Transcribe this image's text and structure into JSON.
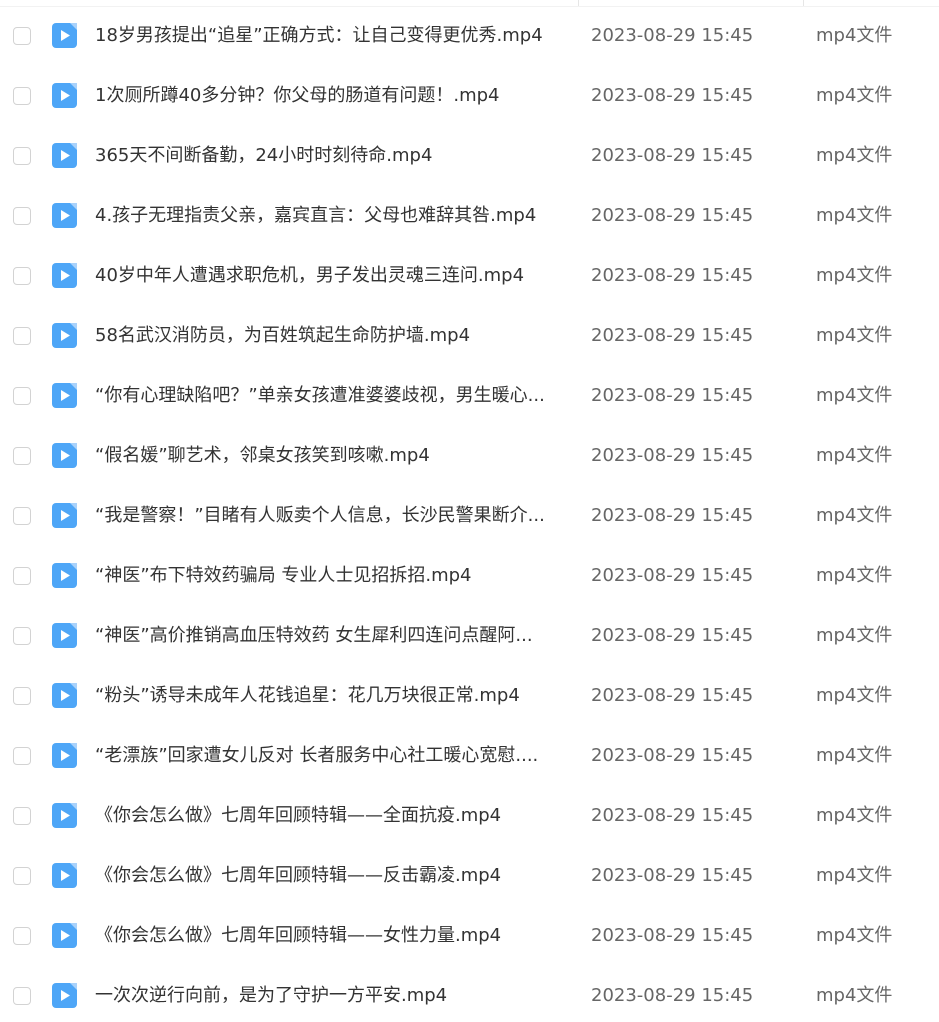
{
  "files": [
    {
      "name": "18岁男孩提出“追星”正确方式：让自己变得更优秀.mp4",
      "date": "2023-08-29 15:45",
      "type": "mp4文件",
      "icon": "video-file-icon"
    },
    {
      "name": "1次厕所蹲40多分钟？你父母的肠道有问题！.mp4",
      "date": "2023-08-29 15:45",
      "type": "mp4文件",
      "icon": "video-file-icon"
    },
    {
      "name": "365天不间断备勤，24小时时刻待命.mp4",
      "date": "2023-08-29 15:45",
      "type": "mp4文件",
      "icon": "video-file-icon"
    },
    {
      "name": "4.孩子无理指责父亲，嘉宾直言：父母也难辞其咎.mp4",
      "date": "2023-08-29 15:45",
      "type": "mp4文件",
      "icon": "video-file-icon"
    },
    {
      "name": "40岁中年人遭遇求职危机，男子发出灵魂三连问.mp4",
      "date": "2023-08-29 15:45",
      "type": "mp4文件",
      "icon": "video-file-icon"
    },
    {
      "name": "58名武汉消防员，为百姓筑起生命防护墙.mp4",
      "date": "2023-08-29 15:45",
      "type": "mp4文件",
      "icon": "video-file-icon"
    },
    {
      "name": "“你有心理缺陷吧？”单亲女孩遭准婆婆歧视，男生暖心...",
      "date": "2023-08-29 15:45",
      "type": "mp4文件",
      "icon": "video-file-icon"
    },
    {
      "name": "“假名媛”聊艺术，邻桌女孩笑到咳嗽.mp4",
      "date": "2023-08-29 15:45",
      "type": "mp4文件",
      "icon": "video-file-icon"
    },
    {
      "name": "“我是警察！”目睹有人贩卖个人信息，长沙民警果断介...",
      "date": "2023-08-29 15:45",
      "type": "mp4文件",
      "icon": "video-file-icon"
    },
    {
      "name": "“神医”布下特效药骗局  专业人士见招拆招.mp4",
      "date": "2023-08-29 15:45",
      "type": "mp4文件",
      "icon": "video-file-icon"
    },
    {
      "name": "“神医”高价推销高血压特效药  女生犀利四连问点醒阿...",
      "date": "2023-08-29 15:45",
      "type": "mp4文件",
      "icon": "video-file-icon"
    },
    {
      "name": "“粉头”诱导未成年人花钱追星：花几万块很正常.mp4",
      "date": "2023-08-29 15:45",
      "type": "mp4文件",
      "icon": "video-file-icon"
    },
    {
      "name": "“老漂族”回家遭女儿反对  长者服务中心社工暖心宽慰....",
      "date": "2023-08-29 15:45",
      "type": "mp4文件",
      "icon": "video-file-icon"
    },
    {
      "name": "《你会怎么做》七周年回顾特辑——全面抗疫.mp4",
      "date": "2023-08-29 15:45",
      "type": "mp4文件",
      "icon": "video-file-icon"
    },
    {
      "name": "《你会怎么做》七周年回顾特辑——反击霸凌.mp4",
      "date": "2023-08-29 15:45",
      "type": "mp4文件",
      "icon": "video-file-icon"
    },
    {
      "name": "《你会怎么做》七周年回顾特辑——女性力量.mp4",
      "date": "2023-08-29 15:45",
      "type": "mp4文件",
      "icon": "video-file-icon"
    },
    {
      "name": "一次次逆行向前，是为了守护一方平安.mp4",
      "date": "2023-08-29 15:45",
      "type": "mp4文件",
      "icon": "video-file-icon"
    }
  ],
  "colors": {
    "icon_bg": "#4ea6f7",
    "text_primary": "#333333",
    "text_secondary": "#666666",
    "checkbox_border": "#d3d3d3"
  }
}
